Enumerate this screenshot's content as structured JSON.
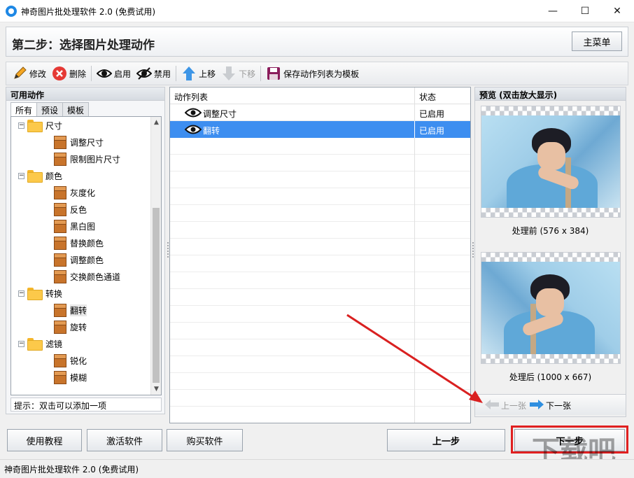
{
  "window": {
    "title": "神奇图片批处理软件 2.0 (免费试用)"
  },
  "header": {
    "step_title": "第二步：选择图片处理动作",
    "main_menu": "主菜单"
  },
  "toolbar": {
    "edit": "修改",
    "delete": "删除",
    "enable": "启用",
    "disable": "禁用",
    "move_up": "上移",
    "move_down": "下移",
    "save_template": "保存动作列表为模板"
  },
  "left_panel": {
    "title": "可用动作",
    "tabs": [
      "所有",
      "预设",
      "模板"
    ],
    "tree": [
      {
        "label": "尺寸",
        "type": "folder"
      },
      {
        "label": "调整尺寸",
        "type": "item"
      },
      {
        "label": "限制图片尺寸",
        "type": "item"
      },
      {
        "label": "颜色",
        "type": "folder"
      },
      {
        "label": "灰度化",
        "type": "item"
      },
      {
        "label": "反色",
        "type": "item"
      },
      {
        "label": "黑白图",
        "type": "item"
      },
      {
        "label": "替换颜色",
        "type": "item"
      },
      {
        "label": "调整颜色",
        "type": "item"
      },
      {
        "label": "交换颜色通道",
        "type": "item"
      },
      {
        "label": "转换",
        "type": "folder"
      },
      {
        "label": "翻转",
        "type": "item"
      },
      {
        "label": "旋转",
        "type": "item"
      },
      {
        "label": "滤镜",
        "type": "folder"
      },
      {
        "label": "锐化",
        "type": "item"
      },
      {
        "label": "模糊",
        "type": "item"
      }
    ],
    "hint": "提示：双击可以添加一项"
  },
  "action_list": {
    "col_name": "动作列表",
    "col_status": "状态",
    "rows": [
      {
        "name": "调整尺寸",
        "status": "已启用",
        "selected": false
      },
      {
        "name": "翻转",
        "status": "已启用",
        "selected": true
      }
    ]
  },
  "preview": {
    "title": "预览 (双击放大显示)",
    "before": "处理前 (576 x 384)",
    "after": "处理后 (1000 x 667)",
    "prev_image": "上一张",
    "next_image": "下一张"
  },
  "bottom": {
    "tutorial": "使用教程",
    "activate": "激活软件",
    "buy": "购买软件",
    "prev_step": "上一步",
    "next_step": "下一步"
  },
  "statusbar": {
    "text": "神奇图片批处理软件 2.0 (免费试用)"
  },
  "colors": {
    "selection": "#3d8ef0",
    "annotation": "#e02020"
  }
}
